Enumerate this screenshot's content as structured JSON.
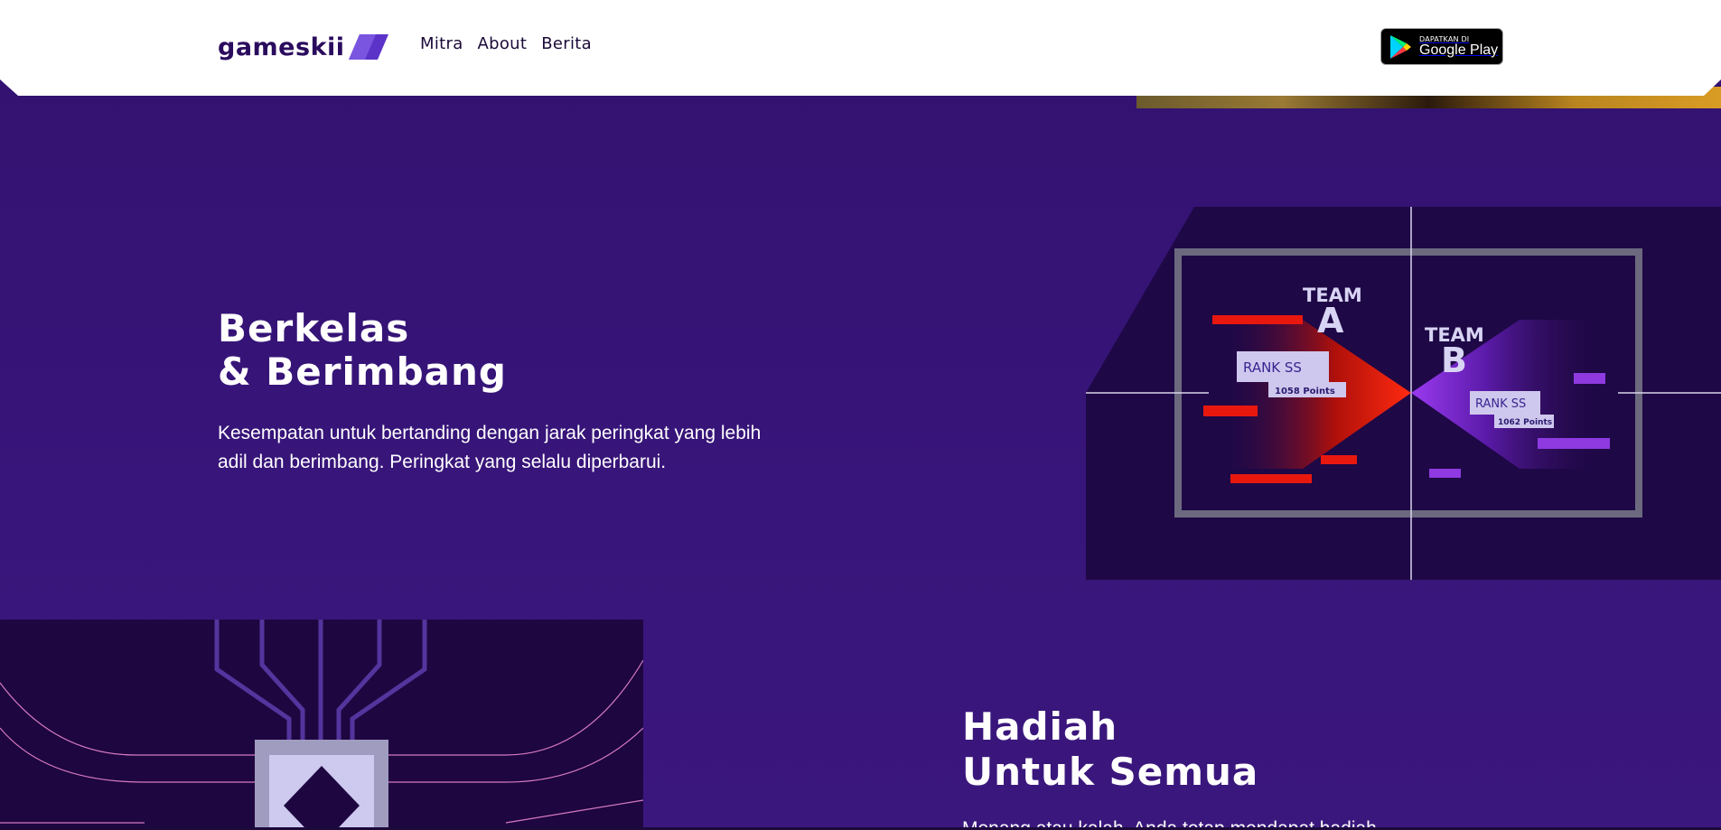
{
  "header": {
    "logo_text": "gameskii",
    "nav": [
      "Mitra",
      "About",
      "Berita"
    ],
    "store_badge": {
      "small": "DAPATKAN DI",
      "big": "Google Play"
    }
  },
  "section1": {
    "title_line1": "Berkelas",
    "title_line2": "& Berimbang",
    "description": "Kesempatan untuk bertanding dengan jarak peringkat yang lebih adil dan berimbang. Peringkat yang selalu diperbarui."
  },
  "rank_visual": {
    "team_a": {
      "word": "TEAM",
      "letter": "A",
      "rank": "RANK SS",
      "points": "1058 Points"
    },
    "team_b": {
      "word": "TEAM",
      "letter": "B",
      "rank": "RANK SS",
      "points": "1062 Points"
    }
  },
  "section2": {
    "title_line1": "Hadiah",
    "title_line2": "Untuk Semua",
    "description": "Menang atau kalah, Anda tetap mendapat hadiah"
  },
  "colors": {
    "background": "#351470",
    "accent": "#2a0c5e",
    "team_a": "#e0140c",
    "team_b": "#8a2be2"
  }
}
